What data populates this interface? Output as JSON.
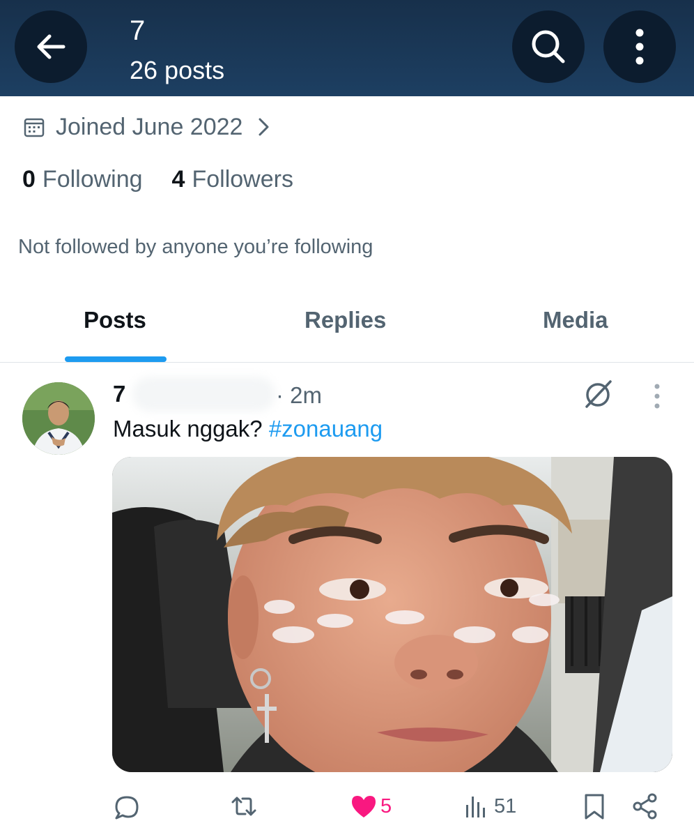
{
  "header": {
    "name": "7",
    "post_count": "26 posts"
  },
  "profile": {
    "joined": "Joined June 2022",
    "following_count": "0",
    "following_label": "Following",
    "followers_count": "4",
    "followers_label": "Followers",
    "mutuals_note": "Not followed by anyone you’re following"
  },
  "tabs": [
    {
      "label": "Posts",
      "active": true
    },
    {
      "label": "Replies",
      "active": false
    },
    {
      "label": "Media",
      "active": false
    }
  ],
  "post": {
    "author": "7",
    "time": "· 2m",
    "text": "Masuk nggak? ",
    "hashtag": "#zonauang",
    "actions": {
      "replies": "",
      "reposts": "",
      "likes": "5",
      "views": "51"
    }
  },
  "colors": {
    "header_bg": "#1b3a5a",
    "accent": "#1d9bf0",
    "like": "#f91880",
    "muted": "#536471"
  }
}
